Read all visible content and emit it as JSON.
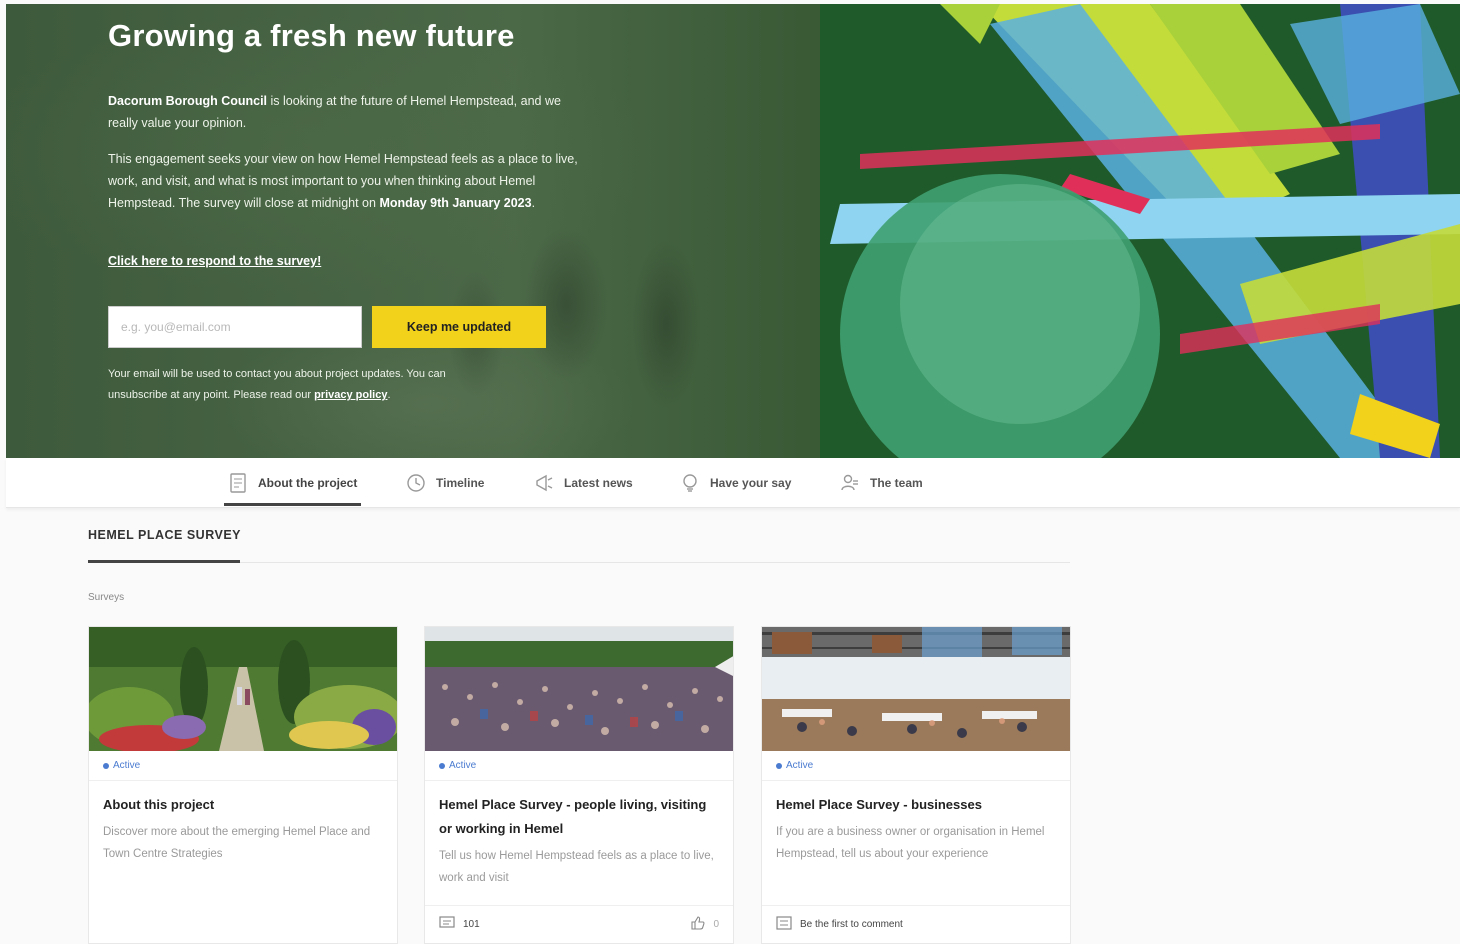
{
  "hero": {
    "title": "Growing a fresh new future",
    "intro_org": "Dacorum Borough Council",
    "intro_rest": " is looking at the future of Hemel Hempstead, and we really value your opinion.",
    "para2": "This engagement seeks your view on how Hemel Hempstead feels as a place to live, work, and visit, and what is most important to you when thinking about Hemel Hempstead. The survey will close at midnight on ",
    "close_date": "Monday 9th January 2023",
    "close_suffix": ".",
    "survey_link": "Click here to respond to the survey!",
    "email_placeholder": "e.g. you@email.com",
    "keep_button": "Keep me updated",
    "disclaimer": "Your email will be used to contact you about project updates. You can unsubscribe at any point. Please read our ",
    "privacy_link": "privacy policy",
    "disclaimer_end": "."
  },
  "tabs": [
    {
      "label": "About the project",
      "icon": "document-icon",
      "active": true
    },
    {
      "label": "Timeline",
      "icon": "clock-icon"
    },
    {
      "label": "Latest news",
      "icon": "megaphone-icon"
    },
    {
      "label": "Have your say",
      "icon": "lightbulb-icon"
    },
    {
      "label": "The team",
      "icon": "people-icon"
    }
  ],
  "section": {
    "title": "HEMEL PLACE SURVEY",
    "surveys_label": "Surveys"
  },
  "cards": [
    {
      "status": "Active",
      "title": "About this project",
      "desc": "Discover more about the emerging Hemel Place and Town Centre Strategies",
      "footer_left": "",
      "footer_right": ""
    },
    {
      "status": "Active",
      "title": "Hemel Place Survey - people living, visiting or working in Hemel",
      "desc": "Tell us how Hemel Hempstead feels as a place to live, work and visit",
      "footer_left": "101",
      "footer_right": "0"
    },
    {
      "status": "Active",
      "title": "Hemel Place Survey - businesses",
      "desc": "If you are a business owner or organisation in Hemel Hempstead, tell us about your experience",
      "footer_left": "Be the first to comment",
      "footer_right": ""
    }
  ],
  "colors": {
    "accent_yellow": "#f2d21a",
    "status_blue": "#4a7bd0",
    "hero_green": "#3e5a3c"
  }
}
